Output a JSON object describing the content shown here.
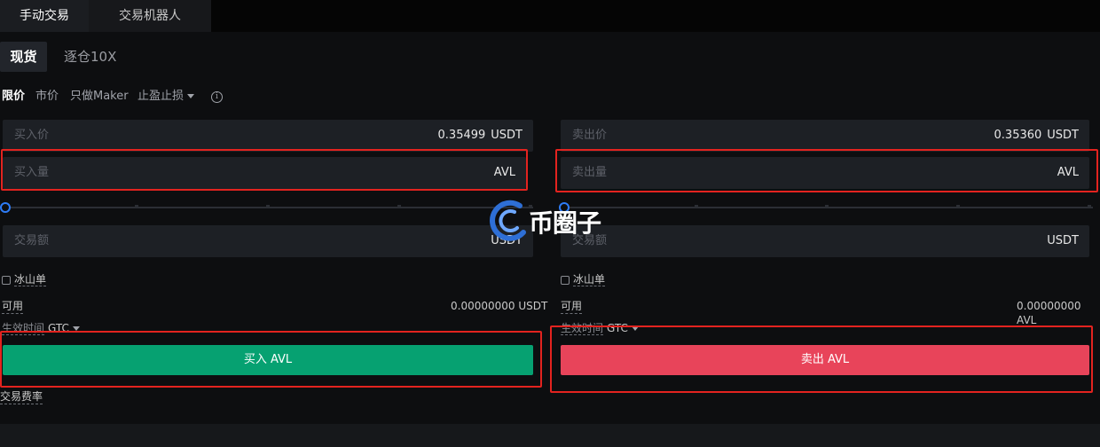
{
  "tabs": {
    "manual": "手动交易",
    "bot": "交易机器人"
  },
  "subtabs": {
    "spot": "现货",
    "margin": "逐仓10X"
  },
  "order_types": {
    "limit": "限价",
    "market": "市价",
    "maker_only": "只做Maker",
    "tp_sl": "止盈止损"
  },
  "buy": {
    "price_placeholder": "买入价",
    "price_value": "0.35499",
    "price_unit": "USDT",
    "amount_placeholder": "买入量",
    "amount_unit": "AVL",
    "total_placeholder": "交易额",
    "total_unit": "USDT",
    "iceberg_label": "冰山单",
    "available_label": "可用",
    "available_value": "0.00000000 USDT",
    "tif_label": "生效时间",
    "tif_value": "GTC",
    "button_label": "买入 AVL"
  },
  "sell": {
    "price_placeholder": "卖出价",
    "price_value": "0.35360",
    "price_unit": "USDT",
    "amount_placeholder": "卖出量",
    "amount_unit": "AVL",
    "total_placeholder": "交易额",
    "total_unit": "USDT",
    "iceberg_label": "冰山单",
    "available_label": "可用",
    "available_value": "0.00000000 AVL",
    "tif_label": "生效时间",
    "tif_value": "GTC",
    "button_label": "卖出 AVL"
  },
  "fee_label": "交易费率",
  "watermark": {
    "text": "币圈子"
  },
  "colors": {
    "buy": "#06a171",
    "sell": "#e8445a",
    "accent": "#2e7cf6",
    "highlight": "#e3231f"
  }
}
